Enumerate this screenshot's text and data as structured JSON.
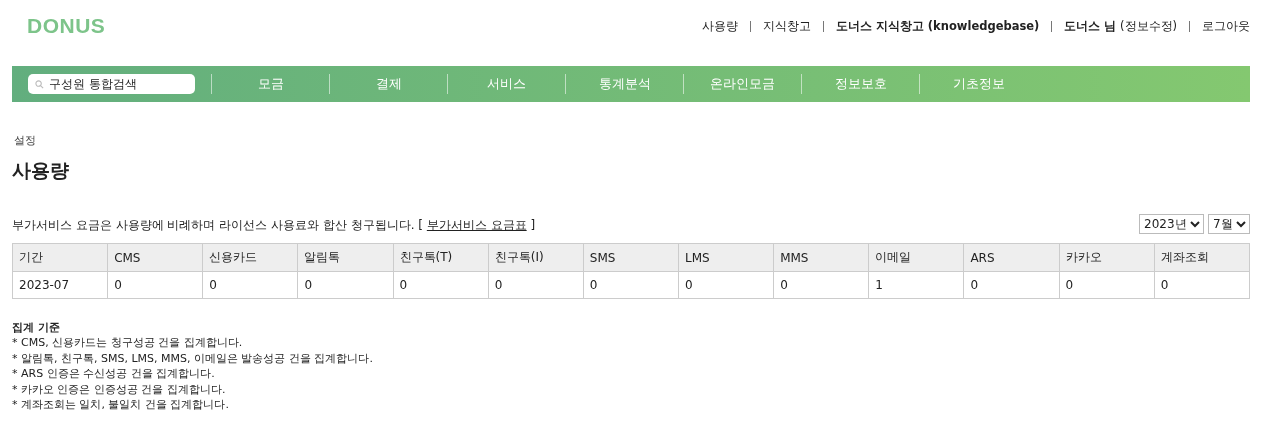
{
  "logo": "DONUS",
  "top_links": [
    {
      "label": "사용량",
      "bold": false
    },
    {
      "label": "지식창고",
      "bold": false
    },
    {
      "label": "도너스 지식창고 (knowledgebase)",
      "bold": true
    },
    {
      "label": "**도너스 님** (정보수정)",
      "bold": false
    },
    {
      "label": "로그아웃",
      "bold": false
    }
  ],
  "search": {
    "placeholder": "구성원 통합검색"
  },
  "menu": [
    "모금",
    "결제",
    "서비스",
    "통계분석",
    "온라인모금",
    "정보보호",
    "기초정보"
  ],
  "breadcrumb": "설정",
  "title": "사용량",
  "intro": {
    "text": "부가서비스 요금은 사용량에 비례하며 라이선스 사용료와 합산 청구됩니다. [",
    "link": "부가서비스 요금표",
    "after": "]"
  },
  "filters": [
    {
      "value": "2023년"
    },
    {
      "value": "7월"
    }
  ],
  "table": {
    "columns": [
      "기간",
      "CMS",
      "신용카드",
      "알림톡",
      "친구톡(T)",
      "친구톡(I)",
      "SMS",
      "LMS",
      "MMS",
      "이메일",
      "ARS",
      "카카오",
      "계좌조회"
    ],
    "rows": [
      [
        "2023-07",
        "0",
        "0",
        "0",
        "0",
        "0",
        "0",
        "0",
        "0",
        "1",
        "0",
        "0",
        "0"
      ]
    ]
  },
  "notes": {
    "title": "집계 기준",
    "lines": [
      "* CMS, 신용카드는 청구성공 건을 집계합니다.",
      "* 알림톡, 친구톡, SMS, LMS, MMS, 이메일은 발송성공 건을 집계합니다.",
      "* ARS 인증은 수신성공 건을 집계합니다.",
      "* 카카오 인증은 인증성공 건을 집계합니다.",
      "* 계좌조회는 일치, 불일치 건을 집계합니다."
    ]
  }
}
